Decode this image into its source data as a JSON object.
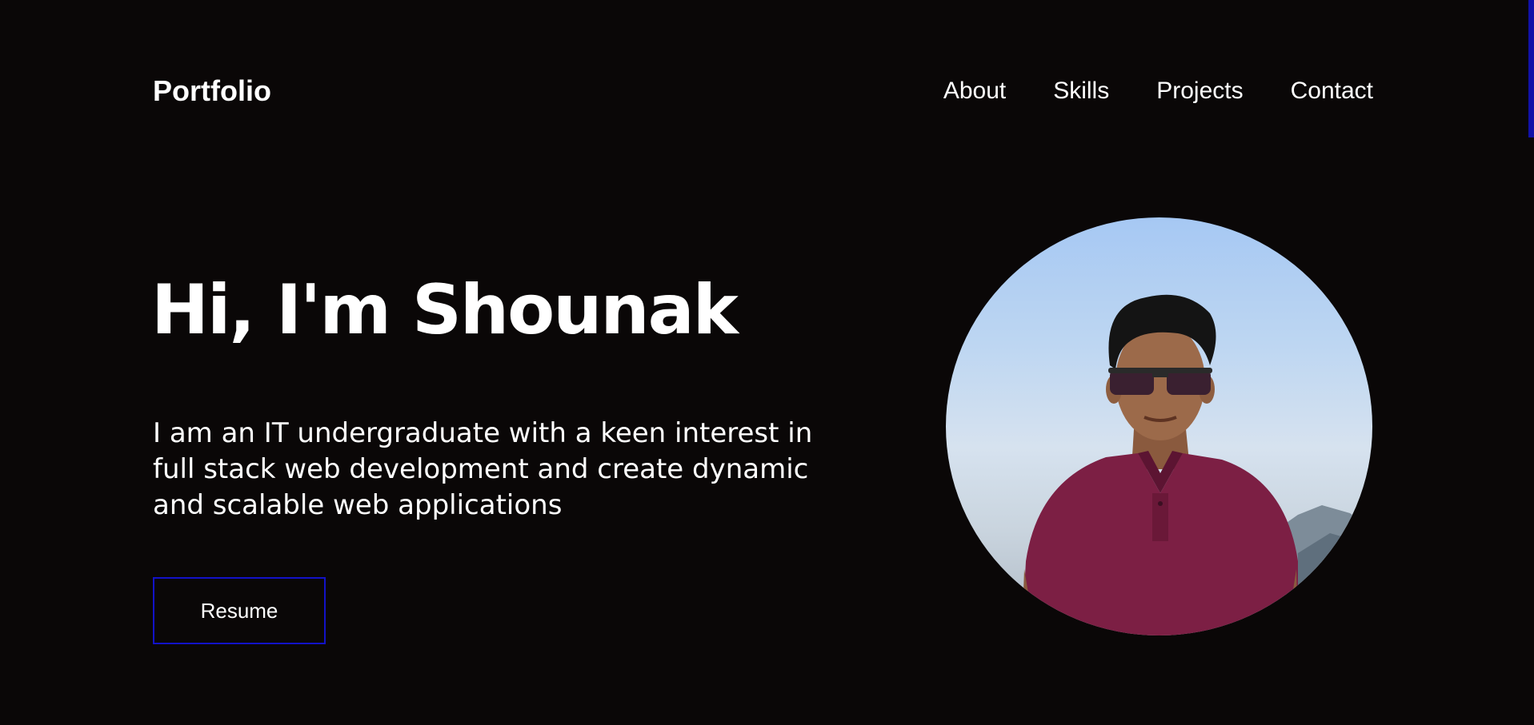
{
  "header": {
    "brand": "Portfolio",
    "nav": [
      {
        "label": "About"
      },
      {
        "label": "Skills"
      },
      {
        "label": "Projects"
      },
      {
        "label": "Contact"
      }
    ]
  },
  "hero": {
    "title": "Hi, I'm Shounak",
    "description": "I am an IT undergraduate with a keen interest in full stack web development and create dynamic and scalable web applications",
    "resume_label": "Resume"
  },
  "colors": {
    "background": "#0a0707",
    "text": "#ffffff",
    "accent": "#1212c8"
  }
}
